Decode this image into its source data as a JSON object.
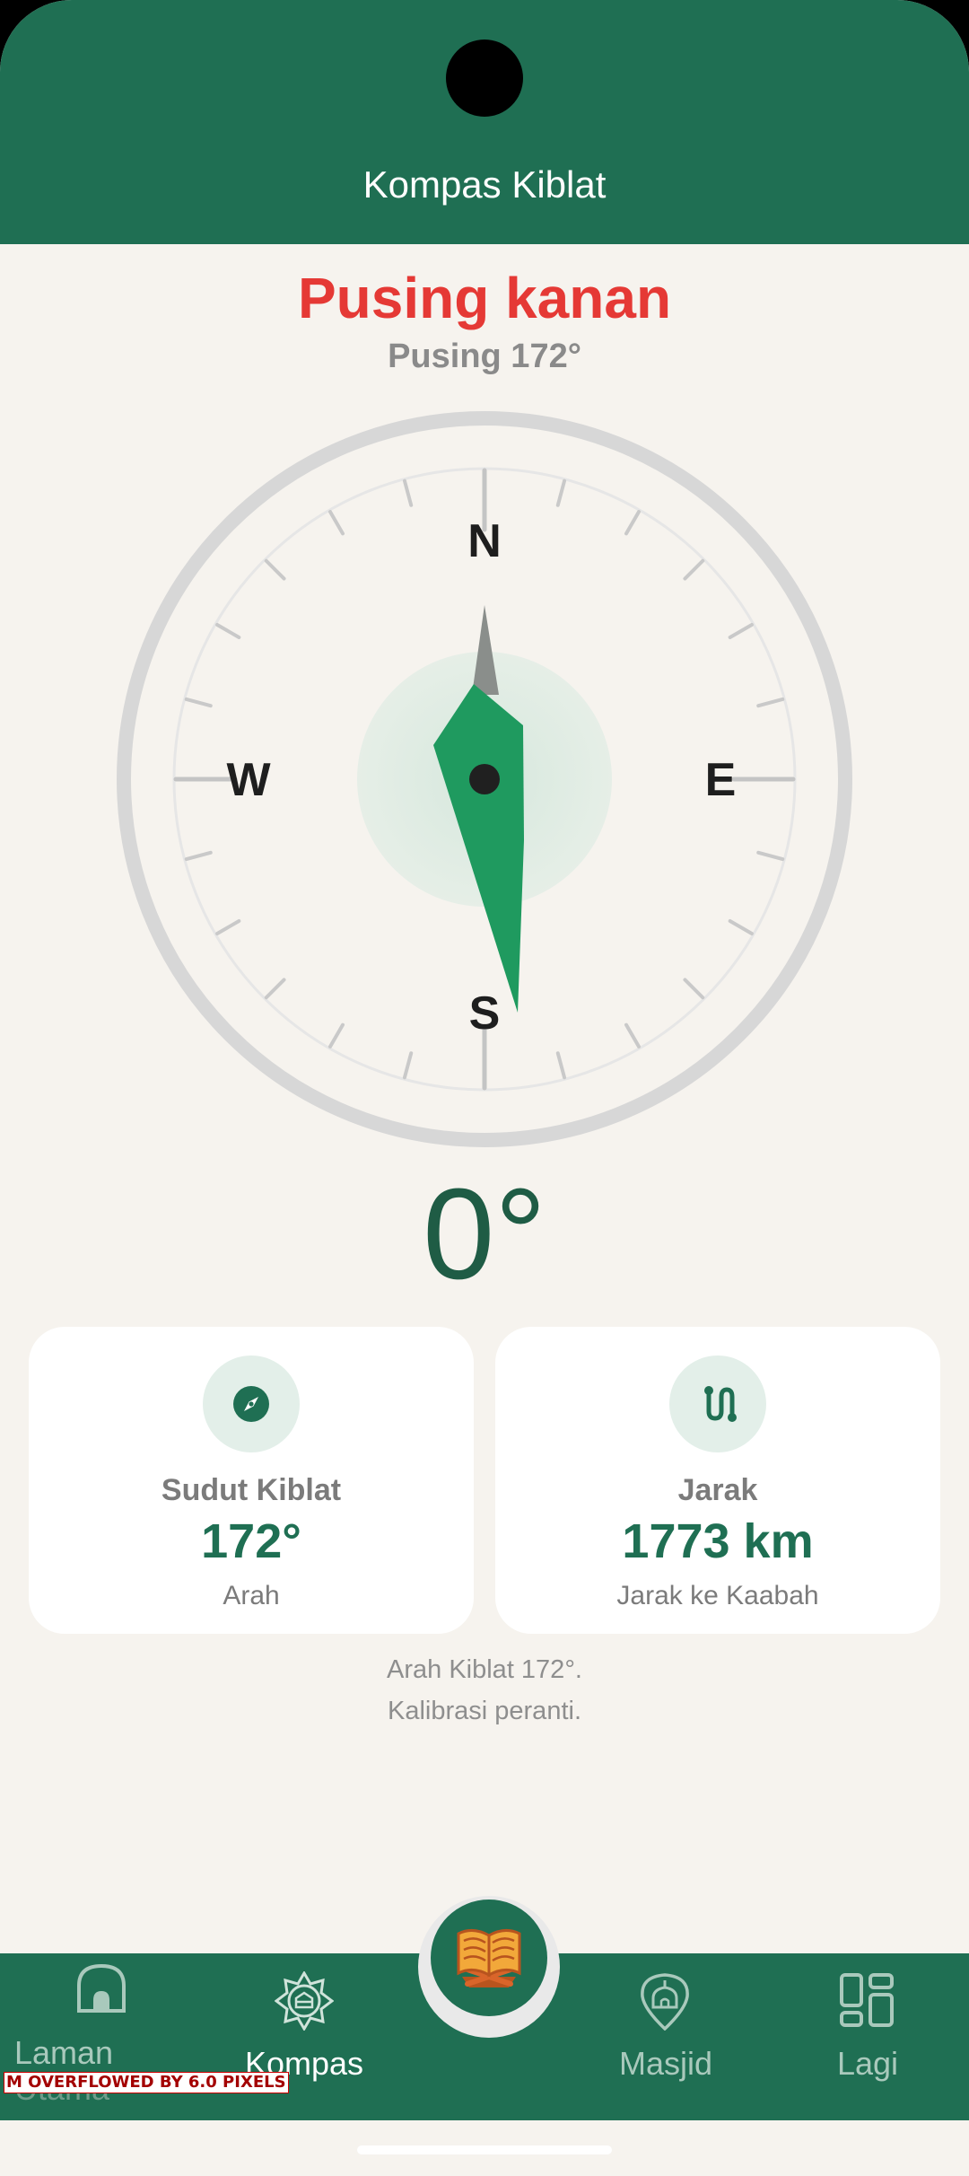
{
  "app_bar": {
    "title": "Kompas Kiblat"
  },
  "status": {
    "instruction": "Pusing kanan",
    "sub_instruction": "Pusing 172°"
  },
  "compass": {
    "cardinals": {
      "north": "N",
      "east": "E",
      "south": "S",
      "west": "W"
    },
    "heading_display": "0°",
    "heading_degrees": 0,
    "qibla_bearing_degrees": 172
  },
  "cards": [
    {
      "icon": "compass-icon",
      "label": "Sudut Kiblat",
      "value": "172°",
      "caption": "Arah"
    },
    {
      "icon": "route-icon",
      "label": "Jarak",
      "value": "1773 km",
      "caption": "Jarak ke Kaabah"
    }
  ],
  "info": {
    "line1": "Arah Kiblat 172°.",
    "line2": "Kalibrasi peranti."
  },
  "bottom_nav": {
    "items": [
      {
        "icon": "home-icon",
        "label_line1": "Laman",
        "label_line2": "Utama",
        "active": false
      },
      {
        "icon": "kompas-icon",
        "label": "Kompas",
        "active": true
      },
      {
        "icon": "quran-icon",
        "label": "",
        "center": true
      },
      {
        "icon": "mosque-pin-icon",
        "label": "Masjid",
        "active": false
      },
      {
        "icon": "grid-icon",
        "label": "Lagi",
        "active": false
      }
    ]
  },
  "debug": {
    "overflow_text": "M OVERFLOWED BY 6.0 PIXELS"
  },
  "colors": {
    "primary": "#1f6f53",
    "alert": "#e53935",
    "background": "#f6f3ee",
    "needle": "#1f9a5f"
  }
}
